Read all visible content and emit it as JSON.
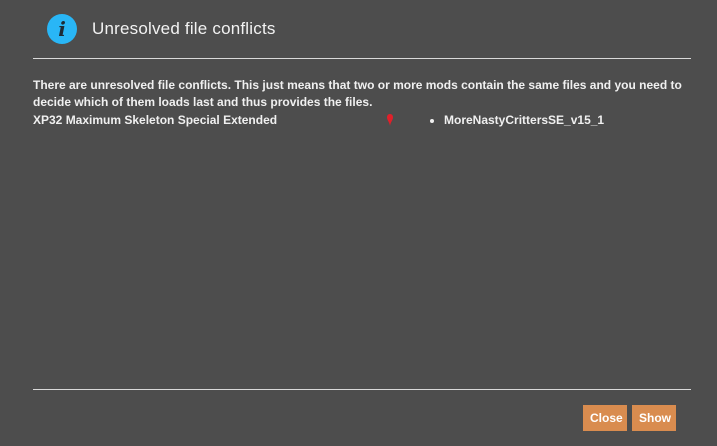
{
  "dialog": {
    "title": "Unresolved file conflicts",
    "icon": "info-icon",
    "icon_glyph": "i",
    "accent_color": "#29b6f6",
    "background_color": "#4d4d4d"
  },
  "content": {
    "description": "There are unresolved file conflicts. This just means that two or more mods contain the same files and you need to decide which of them loads last and thus provides the files.",
    "conflicts": [
      {
        "mod": "XP32 Maximum Skeleton Special Extended",
        "marker_color": "#e0202a",
        "conflicts_with": [
          "MoreNastyCrittersSE_v15_1"
        ]
      }
    ]
  },
  "footer": {
    "close_label": "Close",
    "show_label": "Show",
    "button_color": "#d98c4f"
  }
}
